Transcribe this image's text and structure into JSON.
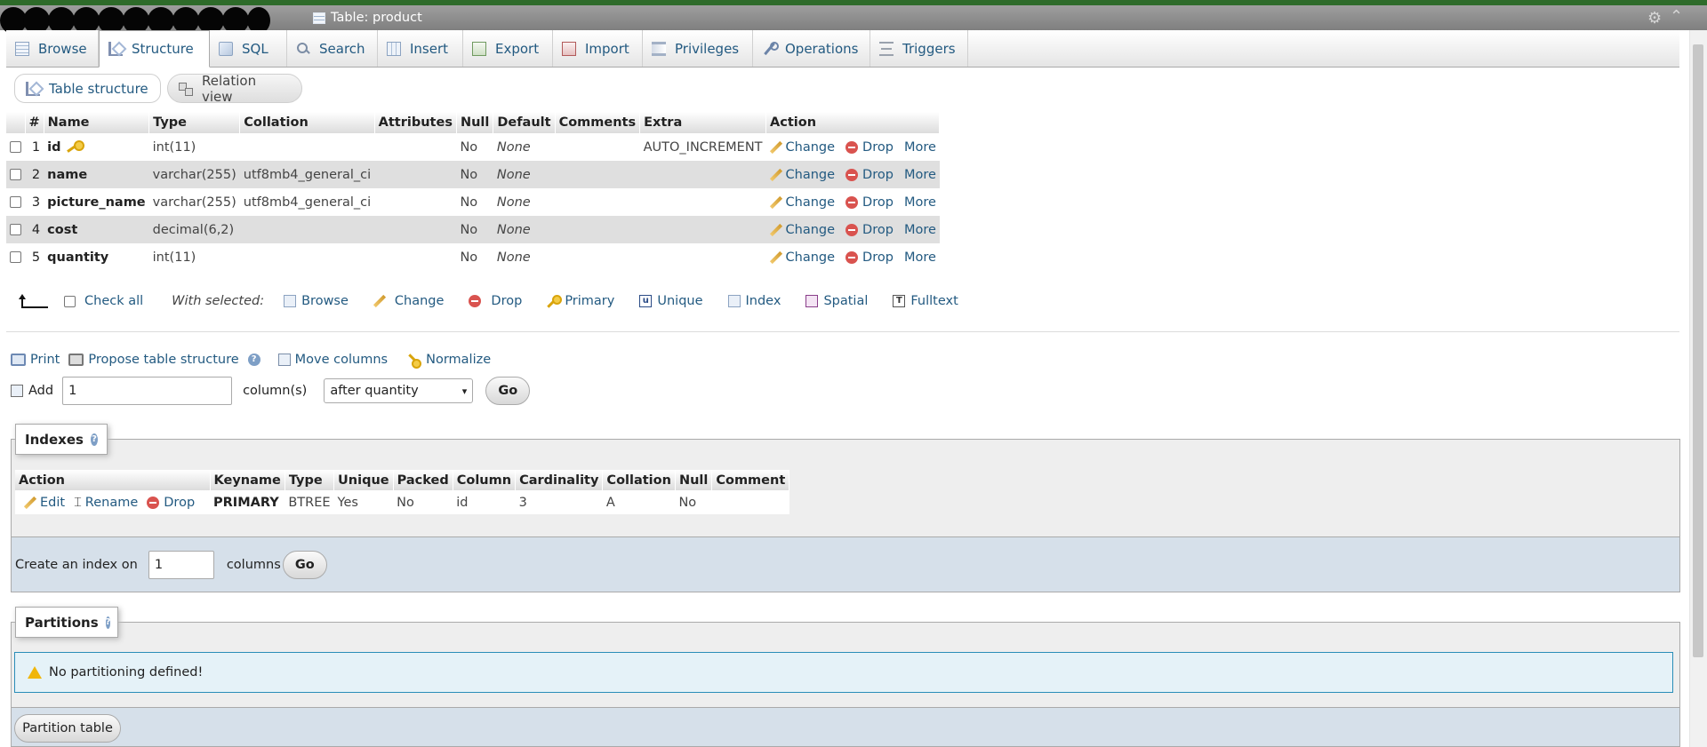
{
  "titlebar": {
    "table_label": "Table: product"
  },
  "tabs": [
    {
      "label": "Browse"
    },
    {
      "label": "Structure"
    },
    {
      "label": "SQL"
    },
    {
      "label": "Search"
    },
    {
      "label": "Insert"
    },
    {
      "label": "Export"
    },
    {
      "label": "Import"
    },
    {
      "label": "Privileges"
    },
    {
      "label": "Operations"
    },
    {
      "label": "Triggers"
    }
  ],
  "subnav": {
    "table_structure": "Table structure",
    "relation_view": "Relation view"
  },
  "structure": {
    "headers": [
      "#",
      "Name",
      "Type",
      "Collation",
      "Attributes",
      "Null",
      "Default",
      "Comments",
      "Extra",
      "Action"
    ],
    "rows": [
      {
        "num": "1",
        "name": "id",
        "type": "int(11)",
        "collation": "",
        "attributes": "",
        "null": "No",
        "default": "None",
        "comments": "",
        "extra": "AUTO_INCREMENT"
      },
      {
        "num": "2",
        "name": "name",
        "type": "varchar(255)",
        "collation": "utf8mb4_general_ci",
        "attributes": "",
        "null": "No",
        "default": "None",
        "comments": "",
        "extra": ""
      },
      {
        "num": "3",
        "name": "picture_name",
        "type": "varchar(255)",
        "collation": "utf8mb4_general_ci",
        "attributes": "",
        "null": "No",
        "default": "None",
        "comments": "",
        "extra": ""
      },
      {
        "num": "4",
        "name": "cost",
        "type": "decimal(6,2)",
        "collation": "",
        "attributes": "",
        "null": "No",
        "default": "None",
        "comments": "",
        "extra": ""
      },
      {
        "num": "5",
        "name": "quantity",
        "type": "int(11)",
        "collation": "",
        "attributes": "",
        "null": "No",
        "default": "None",
        "comments": "",
        "extra": ""
      }
    ],
    "actions": {
      "change": "Change",
      "drop": "Drop",
      "more": "More"
    }
  },
  "with_selected": {
    "check_all": "Check all",
    "label": "With selected:",
    "browse": "Browse",
    "change": "Change",
    "drop": "Drop",
    "primary": "Primary",
    "unique": "Unique",
    "index": "Index",
    "spatial": "Spatial",
    "fulltext": "Fulltext"
  },
  "tools": {
    "print": "Print",
    "propose": "Propose table structure",
    "move_columns": "Move columns",
    "normalize": "Normalize"
  },
  "add_columns": {
    "label": "Add",
    "value": "1",
    "unit": "column(s)",
    "position": "after quantity",
    "go": "Go"
  },
  "indexes": {
    "title": "Indexes",
    "headers": [
      "Action",
      "Keyname",
      "Type",
      "Unique",
      "Packed",
      "Column",
      "Cardinality",
      "Collation",
      "Null",
      "Comment"
    ],
    "row": {
      "edit": "Edit",
      "rename": "Rename",
      "drop": "Drop",
      "keyname": "PRIMARY",
      "type": "BTREE",
      "unique": "Yes",
      "packed": "No",
      "column": "id",
      "cardinality": "3",
      "collation": "A",
      "null": "No",
      "comment": ""
    },
    "create_label": "Create an index on",
    "create_value": "1",
    "create_unit": "columns",
    "go": "Go"
  },
  "partitions": {
    "title": "Partitions",
    "message": "No partitioning defined!",
    "button": "Partition table"
  }
}
